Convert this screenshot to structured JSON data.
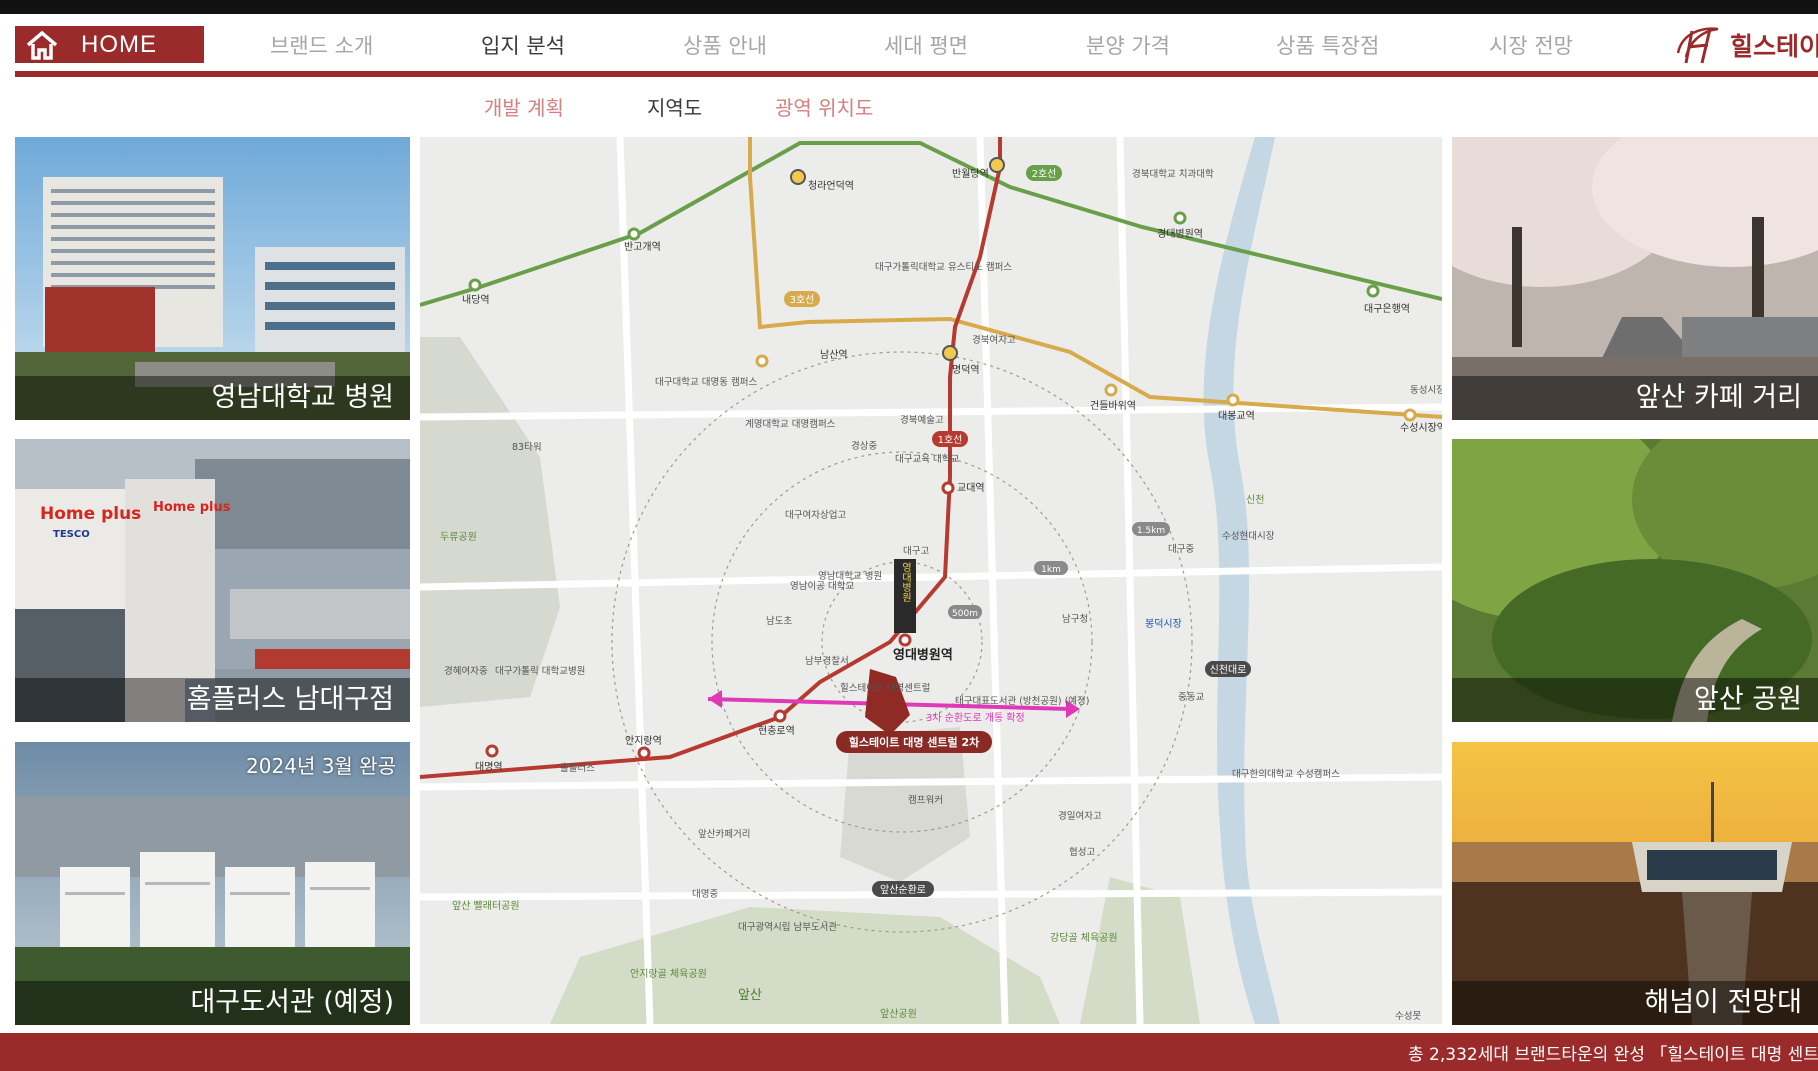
{
  "nav": {
    "home_label": "HOME",
    "items": [
      "브랜드 소개",
      "입지 분석",
      "상품 안내",
      "세대 평면",
      "분양 가격",
      "상품 특장점",
      "시장 전망"
    ],
    "active_index": 1,
    "logo_text": "힐스테이",
    "accent_color": "#9a2b2a"
  },
  "subnav": {
    "items": [
      "개발 계획",
      "지역도",
      "광역 위치도"
    ],
    "active_index": 1
  },
  "photos": {
    "left": [
      {
        "caption": "영남대학교 병원"
      },
      {
        "caption": "홈플러스 남대구점",
        "sign_brand": "Home plus",
        "sign_sub": "TESCO"
      },
      {
        "caption": "대구도서관 (예정)",
        "note": "2024년 3월 완공"
      }
    ],
    "right": [
      {
        "caption": "앞산 카페 거리"
      },
      {
        "caption": "앞산 공원"
      },
      {
        "caption": "해넘이 전망대"
      }
    ]
  },
  "map": {
    "lines": {
      "green": "2호선",
      "orange": "3호선",
      "red": "1호선"
    },
    "stations": [
      "청라언덕역",
      "반월당역",
      "반고개역",
      "내당역",
      "경대병원역",
      "대구은행역",
      "남산역",
      "명덕역",
      "건들바위역",
      "대봉교역",
      "수성시장역",
      "교대역",
      "영대병원역",
      "현충로역",
      "안지랑역",
      "대명역"
    ],
    "places": [
      "경북대학교 치과대학",
      "대구가톨릭대학교 유스티노 캠퍼스",
      "경북여자고",
      "대구대학교 대명동 캠퍼스",
      "계명대학교 대명캠퍼스",
      "경북예술고",
      "경상중",
      "대구교육 대학교",
      "83타워",
      "두류공원",
      "대구여자상업고",
      "대구고",
      "영남대학교 병원",
      "영남이공 대학교",
      "남도초",
      "남부경찰서",
      "경혜여자중",
      "대구가톨릭 대학교병원",
      "홀플러스",
      "앞산카페거리",
      "대명중",
      "대구광역시립 남부도서관",
      "캠프워커",
      "경일여자고",
      "협성고",
      "남구청",
      "봉덕시장",
      "대구중",
      "수성현대시장",
      "중동교",
      "대구한의대학교 수성캠퍼스",
      "동성시장",
      "앞산 빨래터공원",
      "안지랑골 체육공원",
      "강당골 체육공원",
      "앞산공원",
      "대구대표도서관 (방천공원) (예정)",
      "힐스테이트 대명센트럴",
      "수성못",
      "신천",
      "앞산"
    ],
    "roads": [
      "신천대로",
      "앞산순환로"
    ],
    "radius_labels": [
      "500m",
      "1km",
      "1.5km"
    ],
    "site_label": "힐스테이트 대명 센트럴 2차",
    "sign_text": "영대병원",
    "arrow_label": "3차 순환도로 개통 확정"
  },
  "footer": {
    "ticker": "총 2,332세대 브랜드타운의 완성 「힐스테이트 대명 센트"
  }
}
